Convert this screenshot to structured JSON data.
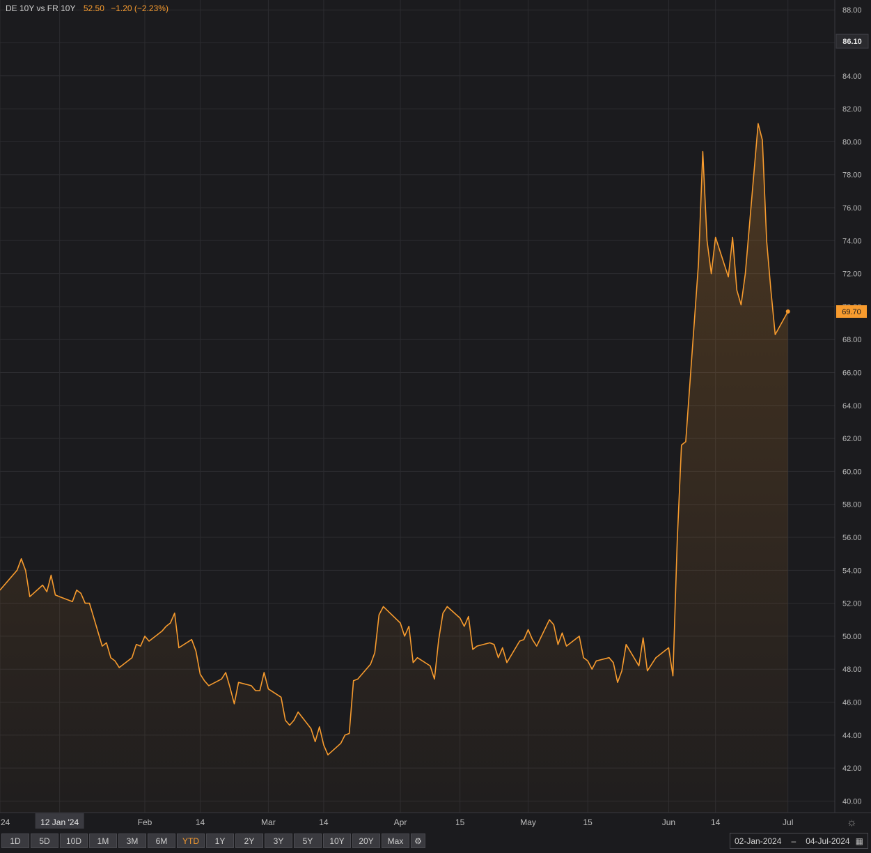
{
  "header": {
    "title": "DE 10Y vs FR 10Y",
    "value": "52.50",
    "change": "−1.20 (−2.23%)"
  },
  "colors": {
    "line": "#f79b2e",
    "background": "#1b1b1e",
    "grid": "#2c2c30",
    "price_tag": "#f79b2e",
    "crosshair_tag": "#2a2a2e"
  },
  "toolbar": {
    "ranges": [
      "1D",
      "5D",
      "10D",
      "1M",
      "3M",
      "6M",
      "YTD",
      "1Y",
      "2Y",
      "3Y",
      "5Y",
      "10Y",
      "20Y",
      "Max"
    ],
    "active": "YTD",
    "settings_icon": "gear-icon"
  },
  "date_range": {
    "start": "02-Jan-2024",
    "separator": "–",
    "end": "04-Jul-2024",
    "icon": "calendar-icon"
  },
  "chart_data": {
    "type": "area",
    "title": "DE 10Y vs FR 10Y",
    "xlabel": "",
    "ylabel": "",
    "ylim": [
      39.3,
      88.6
    ],
    "yticks": [
      40,
      42,
      44,
      46,
      48,
      50,
      52,
      54,
      56,
      58,
      60,
      62,
      64,
      66,
      68,
      70,
      72,
      74,
      76,
      78,
      80,
      82,
      84,
      86,
      88
    ],
    "ytick_labels": [
      "40.00",
      "42.00",
      "44.00",
      "46.00",
      "48.00",
      "50.00",
      "52.00",
      "54.00",
      "56.00",
      "58.00",
      "60.00",
      "62.00",
      "64.00",
      "66.00",
      "68.00",
      "70.00",
      "72.00",
      "74.00",
      "76.00",
      "78.00",
      "80.00",
      "82.00",
      "84.00",
      "86.00",
      "88.00"
    ],
    "xlim": [
      "2023-12-29",
      "2024-07-12"
    ],
    "x_ticks": [
      {
        "date": "2023-12-29",
        "label": "24"
      },
      {
        "date": "2024-01-12",
        "label": "12 Jan '24"
      },
      {
        "date": "2024-02-01",
        "label": "Feb"
      },
      {
        "date": "2024-02-14",
        "label": "14"
      },
      {
        "date": "2024-03-01",
        "label": "Mar"
      },
      {
        "date": "2024-03-14",
        "label": "14"
      },
      {
        "date": "2024-04-01",
        "label": "Apr"
      },
      {
        "date": "2024-04-15",
        "label": "15"
      },
      {
        "date": "2024-05-01",
        "label": "May"
      },
      {
        "date": "2024-05-15",
        "label": "15"
      },
      {
        "date": "2024-06-03",
        "label": "Jun"
      },
      {
        "date": "2024-06-14",
        "label": "14"
      },
      {
        "date": "2024-07-01",
        "label": "Jul"
      }
    ],
    "grid": true,
    "crosshair": {
      "date": "2024-01-12",
      "label": "12 Jan '24",
      "value": 86.1,
      "value_label": "86.10"
    },
    "last": {
      "value": 69.7,
      "label": "69.70"
    },
    "series": [
      {
        "color": "#f79b2e",
        "points": [
          [
            "2023-12-29",
            52.8
          ],
          [
            "2024-01-02",
            54.0
          ],
          [
            "2024-01-03",
            54.7
          ],
          [
            "2024-01-04",
            54.0
          ],
          [
            "2024-01-05",
            52.4
          ],
          [
            "2024-01-08",
            53.1
          ],
          [
            "2024-01-09",
            52.7
          ],
          [
            "2024-01-10",
            53.7
          ],
          [
            "2024-01-11",
            52.5
          ],
          [
            "2024-01-12",
            52.4
          ],
          [
            "2024-01-15",
            52.1
          ],
          [
            "2024-01-16",
            52.8
          ],
          [
            "2024-01-17",
            52.6
          ],
          [
            "2024-01-18",
            52.0
          ],
          [
            "2024-01-19",
            52.0
          ],
          [
            "2024-01-22",
            49.4
          ],
          [
            "2024-01-23",
            49.6
          ],
          [
            "2024-01-24",
            48.7
          ],
          [
            "2024-01-25",
            48.5
          ],
          [
            "2024-01-26",
            48.1
          ],
          [
            "2024-01-29",
            48.7
          ],
          [
            "2024-01-30",
            49.5
          ],
          [
            "2024-01-31",
            49.4
          ],
          [
            "2024-02-01",
            50.0
          ],
          [
            "2024-02-02",
            49.7
          ],
          [
            "2024-02-05",
            50.3
          ],
          [
            "2024-02-06",
            50.6
          ],
          [
            "2024-02-07",
            50.8
          ],
          [
            "2024-02-08",
            51.4
          ],
          [
            "2024-02-09",
            49.3
          ],
          [
            "2024-02-12",
            49.8
          ],
          [
            "2024-02-13",
            49.1
          ],
          [
            "2024-02-14",
            47.7
          ],
          [
            "2024-02-15",
            47.3
          ],
          [
            "2024-02-16",
            47.0
          ],
          [
            "2024-02-19",
            47.4
          ],
          [
            "2024-02-20",
            47.8
          ],
          [
            "2024-02-21",
            46.9
          ],
          [
            "2024-02-22",
            45.9
          ],
          [
            "2024-02-23",
            47.2
          ],
          [
            "2024-02-26",
            47.0
          ],
          [
            "2024-02-27",
            46.7
          ],
          [
            "2024-02-28",
            46.7
          ],
          [
            "2024-02-29",
            47.8
          ],
          [
            "2024-03-01",
            46.8
          ],
          [
            "2024-03-04",
            46.3
          ],
          [
            "2024-03-05",
            44.9
          ],
          [
            "2024-03-06",
            44.6
          ],
          [
            "2024-03-07",
            44.9
          ],
          [
            "2024-03-08",
            45.4
          ],
          [
            "2024-03-11",
            44.4
          ],
          [
            "2024-03-12",
            43.6
          ],
          [
            "2024-03-13",
            44.5
          ],
          [
            "2024-03-14",
            43.4
          ],
          [
            "2024-03-15",
            42.8
          ],
          [
            "2024-03-18",
            43.5
          ],
          [
            "2024-03-19",
            44.0
          ],
          [
            "2024-03-20",
            44.1
          ],
          [
            "2024-03-21",
            47.3
          ],
          [
            "2024-03-22",
            47.4
          ],
          [
            "2024-03-25",
            48.3
          ],
          [
            "2024-03-26",
            49.0
          ],
          [
            "2024-03-27",
            51.3
          ],
          [
            "2024-03-28",
            51.8
          ],
          [
            "2024-04-01",
            50.8
          ],
          [
            "2024-04-02",
            50.0
          ],
          [
            "2024-04-03",
            50.6
          ],
          [
            "2024-04-04",
            48.4
          ],
          [
            "2024-04-05",
            48.7
          ],
          [
            "2024-04-08",
            48.2
          ],
          [
            "2024-04-09",
            47.4
          ],
          [
            "2024-04-10",
            49.8
          ],
          [
            "2024-04-11",
            51.4
          ],
          [
            "2024-04-12",
            51.8
          ],
          [
            "2024-04-15",
            51.1
          ],
          [
            "2024-04-16",
            50.6
          ],
          [
            "2024-04-17",
            51.2
          ],
          [
            "2024-04-18",
            49.2
          ],
          [
            "2024-04-19",
            49.4
          ],
          [
            "2024-04-22",
            49.6
          ],
          [
            "2024-04-23",
            49.5
          ],
          [
            "2024-04-24",
            48.7
          ],
          [
            "2024-04-25",
            49.3
          ],
          [
            "2024-04-26",
            48.4
          ],
          [
            "2024-04-29",
            49.7
          ],
          [
            "2024-04-30",
            49.8
          ],
          [
            "2024-05-01",
            50.4
          ],
          [
            "2024-05-02",
            49.8
          ],
          [
            "2024-05-03",
            49.4
          ],
          [
            "2024-05-06",
            51.0
          ],
          [
            "2024-05-07",
            50.7
          ],
          [
            "2024-05-08",
            49.5
          ],
          [
            "2024-05-09",
            50.2
          ],
          [
            "2024-05-10",
            49.4
          ],
          [
            "2024-05-13",
            50.0
          ],
          [
            "2024-05-14",
            48.7
          ],
          [
            "2024-05-15",
            48.5
          ],
          [
            "2024-05-16",
            48.0
          ],
          [
            "2024-05-17",
            48.5
          ],
          [
            "2024-05-20",
            48.7
          ],
          [
            "2024-05-21",
            48.4
          ],
          [
            "2024-05-22",
            47.2
          ],
          [
            "2024-05-23",
            47.9
          ],
          [
            "2024-05-24",
            49.5
          ],
          [
            "2024-05-27",
            48.2
          ],
          [
            "2024-05-28",
            49.9
          ],
          [
            "2024-05-29",
            47.9
          ],
          [
            "2024-05-30",
            48.3
          ],
          [
            "2024-05-31",
            48.7
          ],
          [
            "2024-06-03",
            49.3
          ],
          [
            "2024-06-04",
            47.6
          ],
          [
            "2024-06-05",
            55.8
          ],
          [
            "2024-06-06",
            61.6
          ],
          [
            "2024-06-07",
            61.8
          ],
          [
            "2024-06-10",
            72.6
          ],
          [
            "2024-06-11",
            79.4
          ],
          [
            "2024-06-12",
            74.0
          ],
          [
            "2024-06-13",
            72.0
          ],
          [
            "2024-06-14",
            74.2
          ],
          [
            "2024-06-17",
            71.8
          ],
          [
            "2024-06-18",
            74.2
          ],
          [
            "2024-06-19",
            71.0
          ],
          [
            "2024-06-20",
            70.1
          ],
          [
            "2024-06-21",
            72.0
          ],
          [
            "2024-06-24",
            81.1
          ],
          [
            "2024-06-25",
            80.1
          ],
          [
            "2024-06-26",
            74.0
          ],
          [
            "2024-06-27",
            71.0
          ],
          [
            "2024-06-28",
            68.3
          ],
          [
            "2024-07-01",
            69.7
          ]
        ]
      }
    ]
  }
}
